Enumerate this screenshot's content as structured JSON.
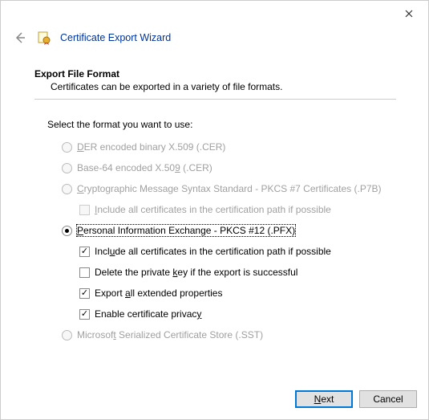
{
  "window": {
    "title": "Certificate Export Wizard"
  },
  "section": {
    "title": "Export File Format",
    "subtitle": "Certificates can be exported in a variety of file formats."
  },
  "prompt": "Select the format you want to use:",
  "options": {
    "der": {
      "prefix": "",
      "accel": "D",
      "rest": "ER encoded binary X.509 (.CER)"
    },
    "base64": {
      "prefix": "Base-64 encoded X.50",
      "accel": "9",
      "rest": " (.CER)"
    },
    "pkcs7": {
      "prefix": "",
      "accel": "C",
      "rest": "ryptographic Message Syntax Standard - PKCS #7 Certificates (.P7B)"
    },
    "pkcs7_sub": {
      "prefix": "",
      "accel": "I",
      "rest": "nclude all certificates in the certification path if possible"
    },
    "pfx": {
      "prefix": "",
      "accel": "P",
      "rest": "ersonal Information Exchange - PKCS #12 (.PFX)"
    },
    "pfx_sub1": {
      "prefix": "Incl",
      "accel": "u",
      "rest": "de all certificates in the certification path if possible"
    },
    "pfx_sub2": {
      "prefix": "Delete the private ",
      "accel": "k",
      "rest": "ey if the export is successful"
    },
    "pfx_sub3": {
      "prefix": "Export ",
      "accel": "a",
      "rest": "ll extended properties"
    },
    "pfx_sub4": {
      "prefix": "Enable certificate privac",
      "accel": "y",
      "rest": ""
    },
    "sst": {
      "prefix": "Microsof",
      "accel": "t",
      "rest": " Serialized Certificate Store (.SST)"
    }
  },
  "buttons": {
    "next_prefix": "",
    "next_accel": "N",
    "next_rest": "ext",
    "cancel": "Cancel"
  }
}
